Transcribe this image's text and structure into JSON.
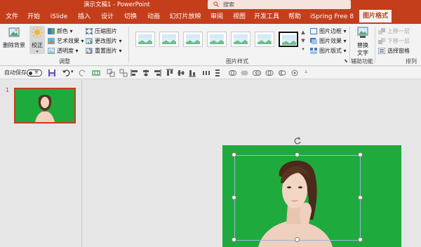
{
  "titlebar": {
    "title": "演示文稿1  -  PowerPoint",
    "search_placeholder": "搜索"
  },
  "tabs": [
    {
      "label": "文件"
    },
    {
      "label": "开始"
    },
    {
      "label": "iSlide"
    },
    {
      "label": "插入"
    },
    {
      "label": "设计"
    },
    {
      "label": "切换"
    },
    {
      "label": "动画"
    },
    {
      "label": "幻灯片放映"
    },
    {
      "label": "审阅"
    },
    {
      "label": "视图"
    },
    {
      "label": "开发工具"
    },
    {
      "label": "帮助"
    },
    {
      "label": "iSpring Free 8"
    },
    {
      "label": "图片格式",
      "active": true
    }
  ],
  "ribbon": {
    "remove_bg": "删除背景",
    "corrections": "校正",
    "color": "颜色",
    "artistic": "艺术效果",
    "transparency": "透明度",
    "compress": "压缩图片",
    "change": "更改图片",
    "reset": "重置图片",
    "adjust_group": "调整",
    "styles_group": "图片样式",
    "border": "图片边框",
    "effects": "图片效果",
    "layout": "图片版式",
    "alt_text_line1": "替换",
    "alt_text_line2": "文字",
    "accessibility_group": "辅助功能",
    "bring_forward": "上移一层",
    "send_backward": "下移一层",
    "selection_pane": "选择窗格",
    "arrange_group": "排列"
  },
  "qat": {
    "autosave_label": "自动保存",
    "autosave_state": "关"
  },
  "slides": [
    {
      "number": "1"
    }
  ],
  "colors": {
    "accent": "#c43e1c",
    "slide_green": "#1faa3e",
    "ribbon_bg": "#f3f3f3"
  }
}
